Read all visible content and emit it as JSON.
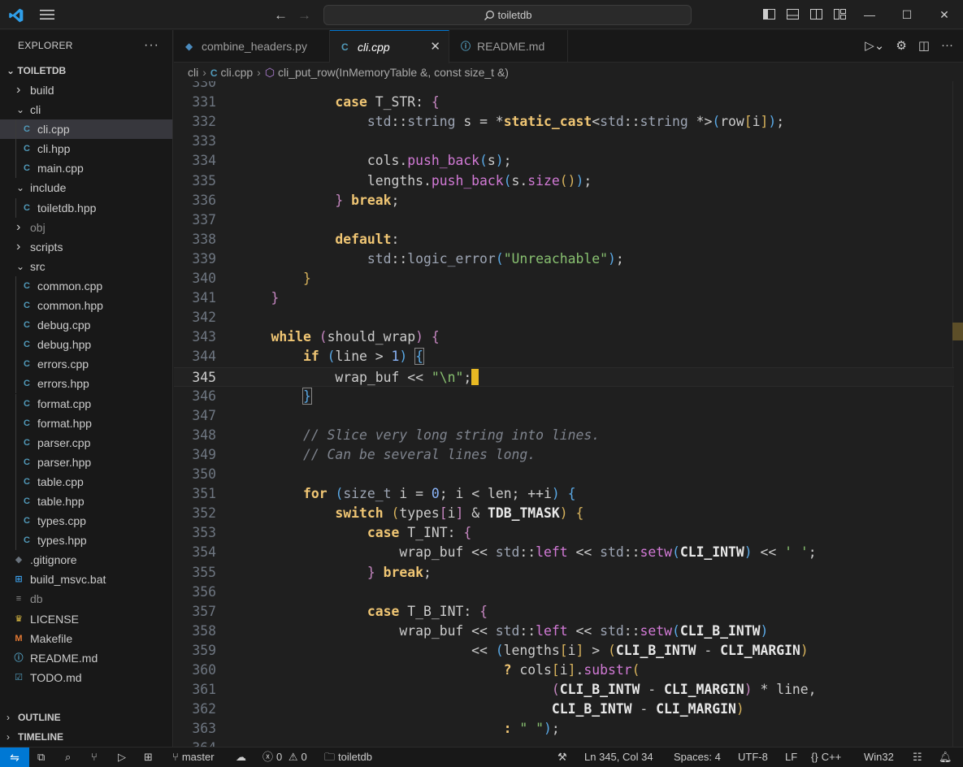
{
  "titlebar": {
    "search_text": "toiletdb",
    "controls": {
      "minimize": "—",
      "maximize": "☐",
      "close": "✕"
    }
  },
  "sidebar": {
    "title": "EXPLORER",
    "root": "TOILETDB",
    "tree": [
      {
        "label": "build",
        "type": "folder",
        "expanded": false,
        "depth": 0
      },
      {
        "label": "cli",
        "type": "folder",
        "expanded": true,
        "depth": 0
      },
      {
        "label": "cli.cpp",
        "type": "cpp",
        "depth": 1,
        "selected": true
      },
      {
        "label": "cli.hpp",
        "type": "cpp",
        "depth": 1
      },
      {
        "label": "main.cpp",
        "type": "cpp",
        "depth": 1
      },
      {
        "label": "include",
        "type": "folder",
        "expanded": true,
        "depth": 0
      },
      {
        "label": "toiletdb.hpp",
        "type": "cpp",
        "depth": 1
      },
      {
        "label": "obj",
        "type": "folder",
        "expanded": false,
        "depth": 0,
        "dim": true
      },
      {
        "label": "scripts",
        "type": "folder",
        "expanded": false,
        "depth": 0
      },
      {
        "label": "src",
        "type": "folder",
        "expanded": true,
        "depth": 0
      },
      {
        "label": "common.cpp",
        "type": "cpp",
        "depth": 1
      },
      {
        "label": "common.hpp",
        "type": "cpp",
        "depth": 1
      },
      {
        "label": "debug.cpp",
        "type": "cpp",
        "depth": 1
      },
      {
        "label": "debug.hpp",
        "type": "cpp",
        "depth": 1
      },
      {
        "label": "errors.cpp",
        "type": "cpp",
        "depth": 1
      },
      {
        "label": "errors.hpp",
        "type": "cpp",
        "depth": 1
      },
      {
        "label": "format.cpp",
        "type": "cpp",
        "depth": 1
      },
      {
        "label": "format.hpp",
        "type": "cpp",
        "depth": 1
      },
      {
        "label": "parser.cpp",
        "type": "cpp",
        "depth": 1
      },
      {
        "label": "parser.hpp",
        "type": "cpp",
        "depth": 1
      },
      {
        "label": "table.cpp",
        "type": "cpp",
        "depth": 1
      },
      {
        "label": "table.hpp",
        "type": "cpp",
        "depth": 1
      },
      {
        "label": "types.cpp",
        "type": "cpp",
        "depth": 1
      },
      {
        "label": "types.hpp",
        "type": "cpp",
        "depth": 1
      },
      {
        "label": ".gitignore",
        "type": "git",
        "depth": 0
      },
      {
        "label": "build_msvc.bat",
        "type": "bat",
        "depth": 0
      },
      {
        "label": "db",
        "type": "db",
        "depth": 0,
        "dim": true
      },
      {
        "label": "LICENSE",
        "type": "license",
        "depth": 0
      },
      {
        "label": "Makefile",
        "type": "make",
        "depth": 0
      },
      {
        "label": "README.md",
        "type": "info",
        "depth": 0
      },
      {
        "label": "TODO.md",
        "type": "todo",
        "depth": 0
      }
    ],
    "outline": "OUTLINE",
    "timeline": "TIMELINE"
  },
  "tabs": [
    {
      "label": "combine_headers.py",
      "icon": "python-icon",
      "active": false
    },
    {
      "label": "cli.cpp",
      "icon": "cpp-icon",
      "active": true,
      "close": "✕"
    },
    {
      "label": "README.md",
      "icon": "info-icon",
      "active": false
    }
  ],
  "breadcrumb": {
    "folder": "cli",
    "file": "cli.cpp",
    "symbol": "cli_put_row(InMemoryTable &, const size_t &)"
  },
  "editor": {
    "current_line": 345,
    "lines": [
      {
        "n": "330",
        "html": ""
      },
      {
        "n": "331",
        "html": "            <span class='kw'>case</span> T_STR: <span class='br2'>{</span>"
      },
      {
        "n": "332",
        "html": "                <span class='ns'>std</span>::<span class='ns'>string</span> s = *<span class='kw'>static_cast</span><<span class='ns'>std</span>::<span class='ns'>string</span> *><span class='br3'>(</span>row<span class='br1'>[</span>i<span class='br1'>]</span><span class='br3'>)</span>;"
      },
      {
        "n": "333",
        "html": ""
      },
      {
        "n": "334",
        "html": "                cols.<span class='fn'>push_back</span><span class='br3'>(</span>s<span class='br3'>)</span>;"
      },
      {
        "n": "335",
        "html": "                lengths.<span class='fn'>push_back</span><span class='br3'>(</span>s.<span class='fn'>size</span><span class='br1'>()</span><span class='br3'>)</span>;"
      },
      {
        "n": "336",
        "html": "            <span class='br2'>}</span> <span class='kw'>break</span>;"
      },
      {
        "n": "337",
        "html": ""
      },
      {
        "n": "338",
        "html": "            <span class='kw'>default</span>:"
      },
      {
        "n": "339",
        "html": "                <span class='ns'>std</span>::<span class='ns'>logic_error</span><span class='br3'>(</span><span class='str'>\"Unreachable\"</span><span class='br3'>)</span>;"
      },
      {
        "n": "340",
        "html": "        <span class='br1'>}</span>"
      },
      {
        "n": "341",
        "html": "    <span class='br2'>}</span>"
      },
      {
        "n": "342",
        "html": ""
      },
      {
        "n": "343",
        "html": "    <span class='kw'>while</span> <span class='br2'>(</span>should_wrap<span class='br2'>)</span> <span class='br2'>{</span>"
      },
      {
        "n": "344",
        "html": "        <span class='kw'>if</span> <span class='br3'>(</span>line > <span class='num'>1</span><span class='br3'>)</span> <span class='br3 bracket-match'>{</span>"
      },
      {
        "n": "345",
        "html": "            wrap_buf << <span class='str'>\"\\n\"</span>;<span class='cursor'></span>"
      },
      {
        "n": "346",
        "html": "        <span class='br3 bracket-match'>}</span>"
      },
      {
        "n": "347",
        "html": ""
      },
      {
        "n": "348",
        "html": "        <span class='cm'>// Slice very long string into lines.</span>"
      },
      {
        "n": "349",
        "html": "        <span class='cm'>// Can be several lines long.</span>"
      },
      {
        "n": "350",
        "html": ""
      },
      {
        "n": "351",
        "html": "        <span class='kw'>for</span> <span class='br3'>(</span><span class='ns'>size_t</span> i = <span class='num'>0</span>; i < len; ++i<span class='br3'>)</span> <span class='br3'>{</span>"
      },
      {
        "n": "352",
        "html": "            <span class='kw'>switch</span> <span class='br1'>(</span>types<span class='br2'>[</span>i<span class='br2'>]</span> & <span class='caps'>TDB_TMASK</span><span class='br1'>)</span> <span class='br1'>{</span>"
      },
      {
        "n": "353",
        "html": "                <span class='kw'>case</span> T_INT: <span class='br2'>{</span>"
      },
      {
        "n": "354",
        "html": "                    wrap_buf << <span class='ns'>std</span>::<span class='fn'>left</span> << <span class='ns'>std</span>::<span class='fn'>setw</span><span class='br3'>(</span><span class='caps'>CLI_INTW</span><span class='br3'>)</span> << <span class='str'>' '</span>;"
      },
      {
        "n": "355",
        "html": "                <span class='br2'>}</span> <span class='kw'>break</span>;"
      },
      {
        "n": "356",
        "html": ""
      },
      {
        "n": "357",
        "html": "                <span class='kw'>case</span> T_B_INT: <span class='br2'>{</span>"
      },
      {
        "n": "358",
        "html": "                    wrap_buf << <span class='ns'>std</span>::<span class='fn'>left</span> << <span class='ns'>std</span>::<span class='fn'>setw</span><span class='br3'>(</span><span class='caps'>CLI_B_INTW</span><span class='br3'>)</span>"
      },
      {
        "n": "359",
        "html": "                             << <span class='br3'>(</span>lengths<span class='br1'>[</span>i<span class='br1'>]</span> > <span class='br1'>(</span><span class='caps'>CLI_B_INTW</span> - <span class='caps'>CLI_MARGIN</span><span class='br1'>)</span>"
      },
      {
        "n": "360",
        "html": "                                 <span class='kw'>?</span> cols<span class='br1'>[</span>i<span class='br1'>]</span>.<span class='fn'>substr</span><span class='br1'>(</span>"
      },
      {
        "n": "361",
        "html": "                                       <span class='br2'>(</span><span class='caps'>CLI_B_INTW</span> - <span class='caps'>CLI_MARGIN</span><span class='br2'>)</span> * line,"
      },
      {
        "n": "362",
        "html": "                                       <span class='caps'>CLI_B_INTW</span> - <span class='caps'>CLI_MARGIN</span><span class='br1'>)</span>"
      },
      {
        "n": "363",
        "html": "                                 <span class='kw'>:</span> <span class='str'>\" \"</span><span class='br3'>)</span>;"
      },
      {
        "n": "364",
        "html": ""
      }
    ]
  },
  "statusbar": {
    "branch": "master",
    "errors": "0",
    "warnings": "0",
    "folder": "toiletdb",
    "position": "Ln 345, Col 34",
    "spaces": "Spaces: 4",
    "encoding": "UTF-8",
    "eol": "LF",
    "language": "C++",
    "platform": "Win32",
    "accent": "#0078d4"
  }
}
